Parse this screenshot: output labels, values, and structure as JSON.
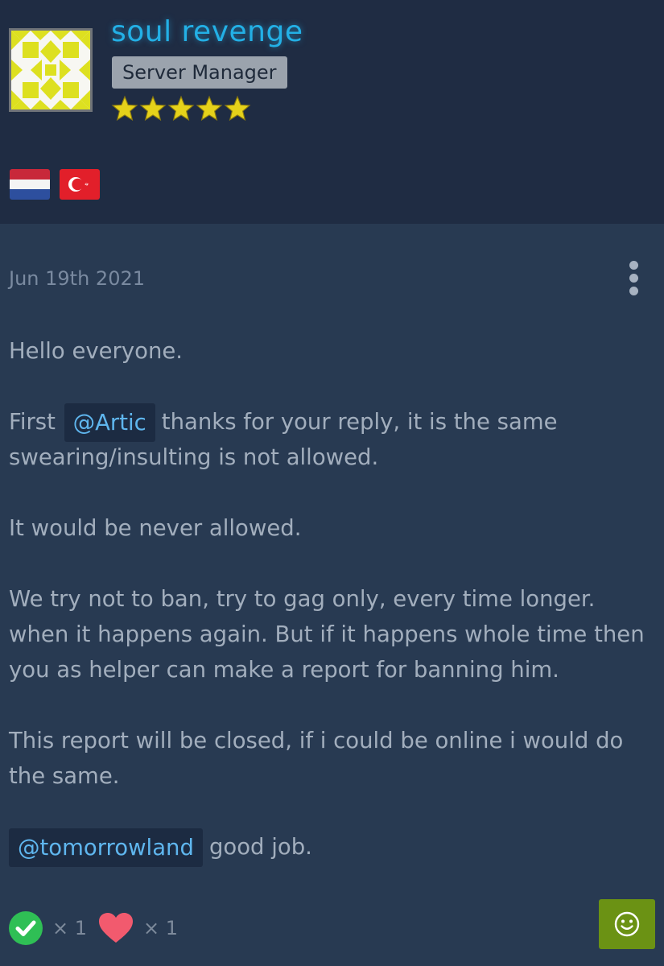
{
  "author": {
    "username": "soul revenge",
    "rank": "Server Manager",
    "star_count": 5,
    "flags": [
      "netherlands-flag",
      "turkey-flag"
    ],
    "colors": {
      "username": "#23b0e6",
      "star": "#e6d21a"
    }
  },
  "post": {
    "date": "Jun 19th 2021",
    "para1": "Hello everyone.",
    "para2_before": "First",
    "para2_mention": "@Artic",
    "para2_after": "thanks for your reply, it is the same swearing/insulting is not allowed.",
    "para3": "It would be never allowed.",
    "para4": "We try not to ban, try to gag only, every time longer. when it happens again. But if it happens whole time then you as helper can make a report for banning him.",
    "para5": "This report will be closed, if i could be online i would do the same.",
    "para6_mention": "@tomorrowland",
    "para6_after": "good job."
  },
  "reactions": [
    {
      "icon": "check-icon",
      "count": "× 1",
      "color": "#2fbf55"
    },
    {
      "icon": "heart-icon",
      "count": "× 1",
      "color": "#f25a6e"
    }
  ],
  "react_button": {
    "icon": "smiley-icon",
    "color": "#6b9214"
  }
}
